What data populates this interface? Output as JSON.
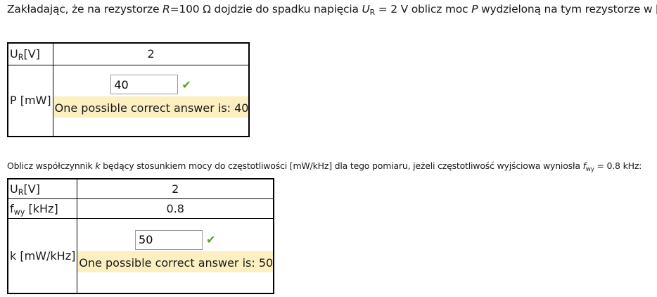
{
  "question1": {
    "text_before_R": "Zakładając, że na rezystorze ",
    "R_symbol": "R",
    "text_R_value": "=100 Ω dojdzie do spadku napięcia ",
    "U_symbol": "U",
    "U_sub": "R",
    "text_after_U": " = 2 V oblicz moc ",
    "P_symbol": "P",
    "text_end": " wydzieloną na tym rezystorze w [mW]:",
    "table": {
      "row1_label": "U",
      "row1_label_sub": "R",
      "row1_label_unit": "[V]",
      "row1_value": "2",
      "row2_label": "P [mW]",
      "answer_value": "40",
      "feedback": "One possible correct answer is: 40"
    }
  },
  "question2": {
    "text_start": "Oblicz współczynnik ",
    "k_symbol": "k",
    "text_mid": " będący stosunkiem mocy do częstotliwości [mW/kHz] dla tego pomiaru, jeżeli częstotliwość wyjściowa wyniosła ",
    "f_symbol": "f",
    "f_sub": "wy",
    "text_end": " = 0.8 kHz:",
    "table": {
      "row1_label": "U",
      "row1_label_sub": "R",
      "row1_label_unit": "[V]",
      "row1_value": "2",
      "row2_label": "f",
      "row2_label_sub": "wy",
      "row2_label_unit": " [kHz]",
      "row2_value": "0.8",
      "row3_label": "k [mW/kHz]",
      "answer_value": "50",
      "feedback": "One possible correct answer is: 50"
    }
  },
  "icons": {
    "correct": "check-icon",
    "correct_color": "#5aa02c"
  }
}
